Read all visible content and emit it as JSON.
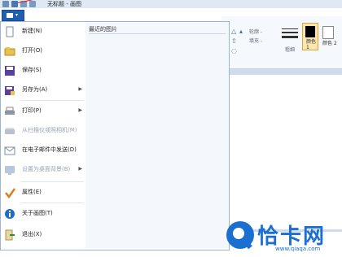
{
  "window": {
    "title": "无标题 - 画图"
  },
  "app_menu": {
    "recent_title": "最近的图片",
    "items": [
      {
        "label": "新建(N)",
        "icon": "new-document-icon",
        "has_submenu": false,
        "enabled": true
      },
      {
        "label": "打开(O)",
        "icon": "open-folder-icon",
        "has_submenu": false,
        "enabled": true
      },
      {
        "label": "保存(S)",
        "icon": "save-disk-icon",
        "has_submenu": false,
        "enabled": true
      },
      {
        "label": "另存为(A)",
        "icon": "save-as-icon",
        "has_submenu": true,
        "enabled": true
      },
      {
        "label": "打印(P)",
        "icon": "printer-icon",
        "has_submenu": true,
        "enabled": true
      },
      {
        "label": "从扫描仪或照相机(M)",
        "icon": "scanner-icon",
        "has_submenu": false,
        "enabled": false
      },
      {
        "label": "在电子邮件中发送(D)",
        "icon": "email-icon",
        "has_submenu": false,
        "enabled": true
      },
      {
        "label": "设置为桌面背景(B)",
        "icon": "desktop-background-icon",
        "has_submenu": true,
        "enabled": false
      },
      {
        "label": "属性(E)",
        "icon": "checkmark-icon",
        "has_submenu": false,
        "enabled": true
      },
      {
        "label": "关于画图(T)",
        "icon": "info-icon",
        "has_submenu": false,
        "enabled": true
      },
      {
        "label": "退出(X)",
        "icon": "exit-icon",
        "has_submenu": false,
        "enabled": true
      }
    ]
  },
  "ribbon": {
    "outline_label": "轮廓 -",
    "fill_label": "填充 -",
    "size_label": "粗细",
    "color1_label": "颜色 1",
    "color2_label": "颜色 2"
  },
  "watermark": {
    "brand": "恰卡网",
    "url": "www.qiaqa.com"
  },
  "colors": {
    "app_button": "#1f5fae",
    "accent": "#1b6fd1",
    "menu_border": "#9fb4cf"
  }
}
